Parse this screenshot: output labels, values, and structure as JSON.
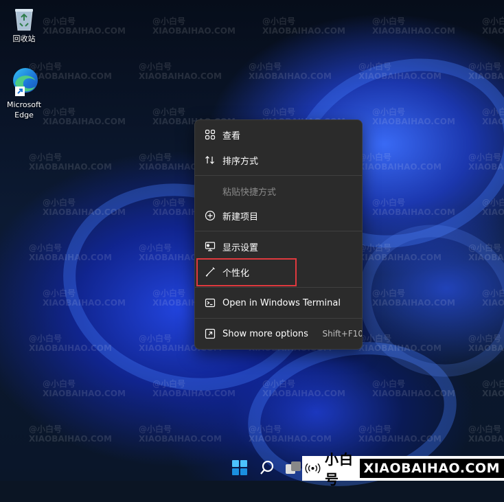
{
  "desktop": {
    "icons": [
      {
        "label": "回收站",
        "icon": "recycle-bin-icon"
      },
      {
        "label": "Microsoft Edge",
        "icon": "edge-icon"
      }
    ]
  },
  "context_menu": {
    "items": [
      {
        "label": "查看",
        "icon": "view-grid-icon",
        "enabled": true
      },
      {
        "label": "排序方式",
        "icon": "sort-icon",
        "enabled": true
      },
      {
        "label": "粘贴快捷方式",
        "icon": "",
        "enabled": false
      },
      {
        "label": "新建项目",
        "icon": "new-item-icon",
        "enabled": true
      },
      {
        "label": "显示设置",
        "icon": "display-settings-icon",
        "enabled": true
      },
      {
        "label": "个性化",
        "icon": "brush-icon",
        "enabled": true,
        "highlighted": true
      },
      {
        "label": "Open in Windows Terminal",
        "icon": "terminal-icon",
        "enabled": true
      },
      {
        "label": "Show more options",
        "icon": "more-options-icon",
        "enabled": true,
        "shortcut": "Shift+F10"
      }
    ]
  },
  "highlight_color": "#e0393e",
  "taskbar": {
    "icons": [
      "start-icon",
      "search-icon",
      "task-view-icon"
    ]
  },
  "watermark": {
    "cn": "小白号",
    "domain": "XIAOBAIHAO.COM",
    "tile_cn": "@小白号",
    "tile_en": "XIAOBAIHAO.COM"
  }
}
